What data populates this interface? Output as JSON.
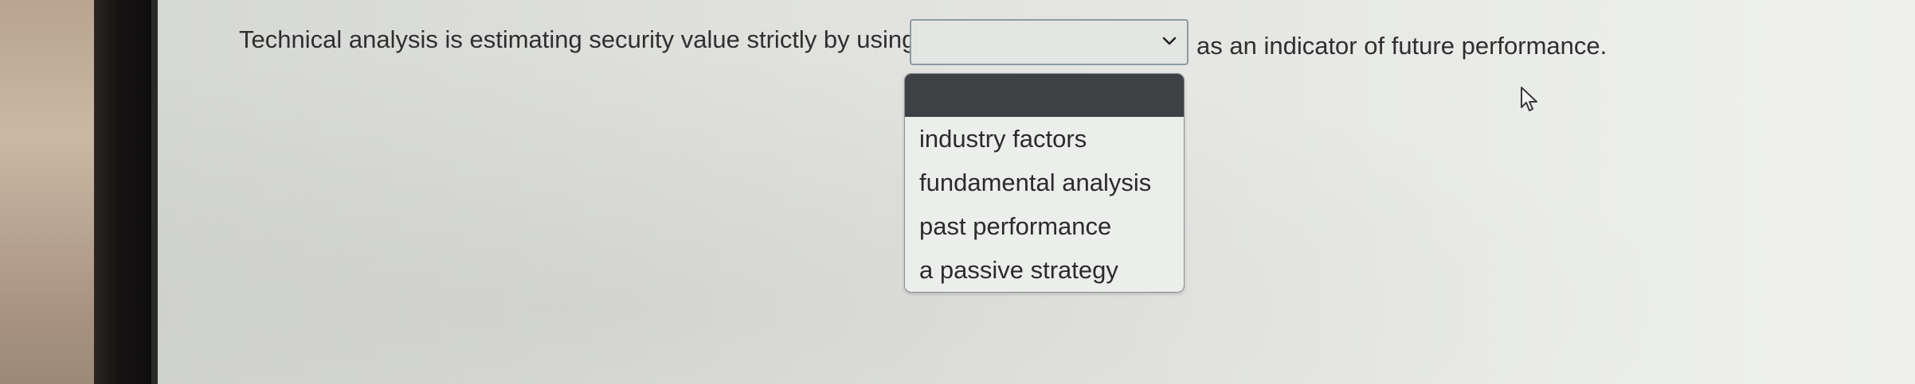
{
  "question": {
    "text_before": "Technical analysis is estimating security value strictly by using",
    "text_after": "as an indicator of future performance."
  },
  "select": {
    "selected_value": "",
    "options": [
      "",
      "industry factors",
      "fundamental analysis",
      "past performance",
      "a passive strategy"
    ]
  },
  "icons": {
    "dropdown": "chevron-down-icon",
    "cursor": "mouse-pointer-icon"
  },
  "colors": {
    "text": "#2f2f2f",
    "highlighted_option": "#3e4043",
    "select_border": "#8e9aa4"
  }
}
